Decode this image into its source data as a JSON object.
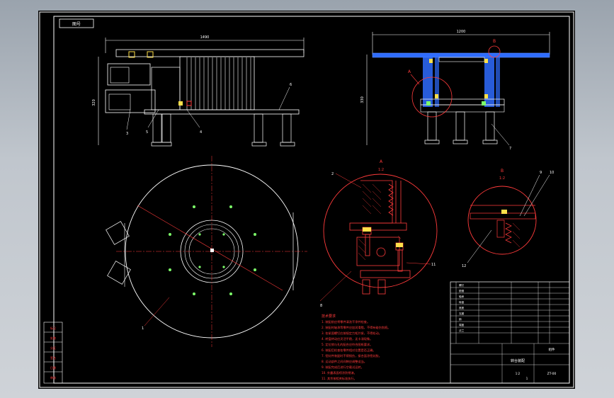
{
  "colors": {
    "background": "#000000",
    "frame": "#ffffff",
    "outline": "#ff3b3b",
    "part_blue": "#2f6cff",
    "part_yellow": "#ffe04a",
    "part_green": "#7dff6a",
    "notes": "#ff3b3b"
  },
  "drawing": {
    "code_box": "图号",
    "top_dim": "1490",
    "front_left_dim": "320",
    "section_top_dim": "1200",
    "section_left_dim": "330",
    "detail_a_label": "A",
    "detail_a_scale": "1:2",
    "detail_b_label": "B",
    "detail_b_scale": "1:2",
    "balloons": [
      "1",
      "2",
      "3",
      "4",
      "5",
      "6",
      "7",
      "8",
      "9",
      "10",
      "11",
      "12"
    ]
  },
  "notes": {
    "title": "技术要求",
    "lines": [
      "1. 装配前应将零件清洗干净并检查。",
      "2. 装配时轴承等零件应加润滑脂，不得有碰伤划痕。",
      "3. 各紧固螺钉应按规定力矩拧紧，不得松动。",
      "4. 转盘转动应灵活平稳，无卡滞现象。",
      "5. 定位销与孔的配合应符合图纸要求。",
      "6. 装配后检查各零件相对位置是否正确。",
      "7. 密封件装配时不得损伤，接合面涂密封胶。",
      "8. 运动部件之间间隙应调整适当。",
      "9. 装配完成后进行空载试运转。",
      "10. 外露表面喷涂防锈漆。",
      "11. 其余按相关标准执行。"
    ]
  },
  "title_block": {
    "name": "转台装配",
    "drawing_no": "ZT-00",
    "scale": "1:2",
    "sheet": "1",
    "material": "组件",
    "rows": [
      "螺钉",
      "垫圈",
      "轴承",
      "转盘",
      "底座",
      "支腿",
      "销",
      "端盖",
      "法兰"
    ]
  },
  "side_panel": {
    "labels": [
      "标记",
      "处数",
      "分区",
      "签名",
      "日期",
      "审核"
    ]
  }
}
